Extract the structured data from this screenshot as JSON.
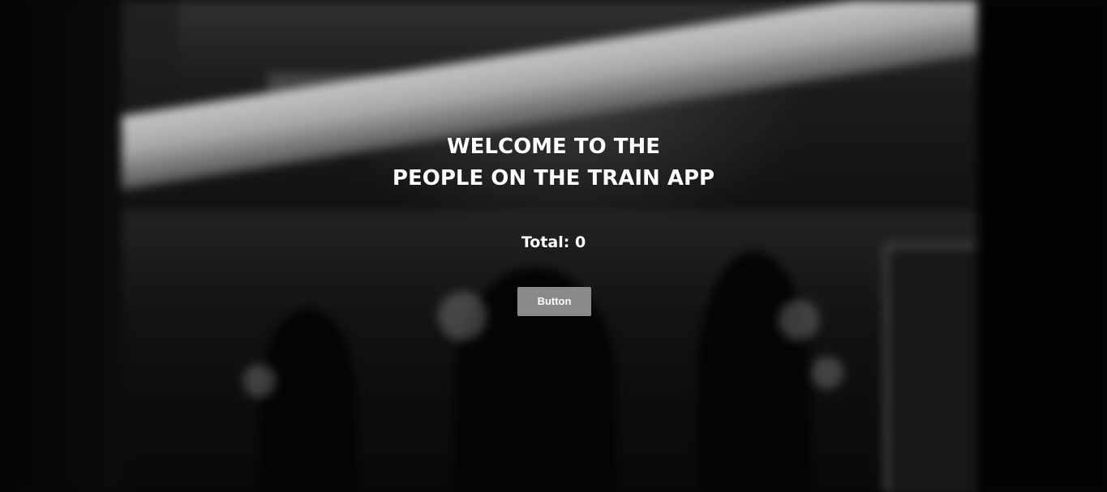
{
  "hero": {
    "title_line1": "WELCOME TO THE",
    "title_line2": "PEOPLE ON THE TRAIN APP",
    "total_label": "Total: 0",
    "button_label": "Button"
  },
  "background": {
    "description_icon": "blurred-train-platform-photo"
  },
  "colors": {
    "text": "#ffffff",
    "button_bg": "#8a8a8a"
  }
}
